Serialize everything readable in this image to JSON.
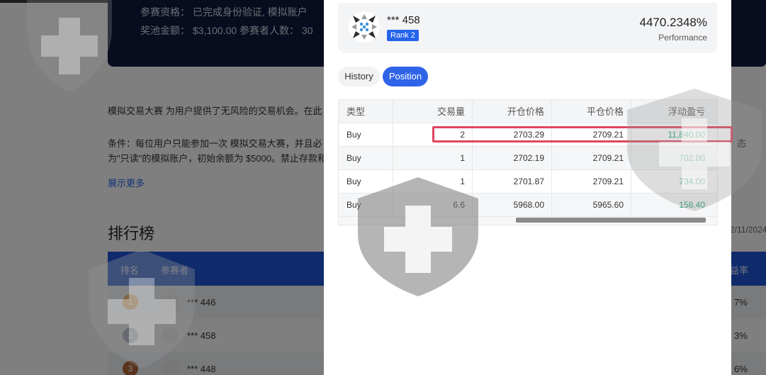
{
  "background": {
    "banner": {
      "line1": "参赛资格：  已完成身份验证, 模拟账户",
      "line2": "奖池金额：  $3,100.00 参赛者人数：  30"
    },
    "description": {
      "line1": "模拟交易大赛 为用户提供了无风险的交易机会。在此",
      "line2": "条件：每位用户只能参加一次 模拟交易大赛，并且必",
      "line2_right": "态",
      "line3": "为\"只读\"的模拟账户，初始余额为 $5000。禁止存款和",
      "show_more": "展示更多"
    },
    "leaderboard": {
      "title": "排行榜",
      "date_partial": "2/11/2024",
      "col_rank": "排名",
      "col_participant": "参赛者",
      "col_rate": "益率",
      "rows": [
        {
          "rank": "1",
          "name": "*** 446",
          "rate": "7%",
          "color": "#e8922e"
        },
        {
          "rank": "2",
          "name": "*** 458",
          "rate": "3%",
          "color": "#9aa4b8"
        },
        {
          "rank": "3",
          "name": "*** 448",
          "rate": "6%",
          "color": "#b5683a"
        }
      ]
    }
  },
  "modal": {
    "user": {
      "name": "*** 458",
      "rank_badge": "Rank 2",
      "performance_value": "4470.2348%",
      "performance_label": "Performance"
    },
    "tabs": {
      "history": "History",
      "position": "Position",
      "active": "Position"
    },
    "table": {
      "headers": [
        "类型",
        "交易量",
        "开仓价格",
        "平仓价格",
        "浮动盈亏"
      ],
      "rows": [
        {
          "type": "Buy",
          "volume": "2",
          "open": "2703.29",
          "close": "2709.21",
          "pnl": "11,840.00"
        },
        {
          "type": "Buy",
          "volume": "1",
          "open": "2702.19",
          "close": "2709.21",
          "pnl": "702.00"
        },
        {
          "type": "Buy",
          "volume": "1",
          "open": "2701.87",
          "close": "2709.21",
          "pnl": "734.00"
        },
        {
          "type": "Buy",
          "volume": "6.6",
          "open": "5968.00",
          "close": "5965.60",
          "pnl": "158.40"
        }
      ]
    }
  },
  "colors": {
    "accent": "#2f63e8",
    "profit": "#22a06b",
    "highlight": "#e0455e"
  }
}
